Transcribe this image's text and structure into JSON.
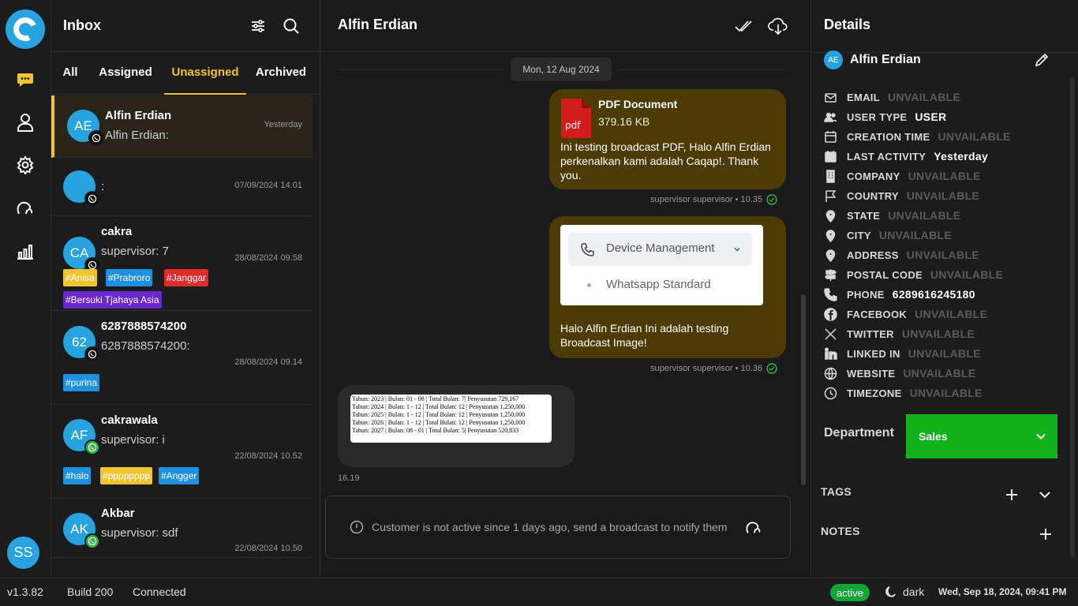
{
  "footer": {
    "version": "v1.3.82",
    "build": "Build 200",
    "connection": "Connected",
    "status": "active",
    "theme": "dark",
    "datetime": "Wed, Sep 18, 2024, 09:41 PM"
  },
  "rail": {
    "avatar": "SS",
    "icons": [
      "chat-icon",
      "contacts-icon",
      "settings-icon",
      "broadcast-icon",
      "analytics-icon"
    ]
  },
  "inbox": {
    "title": "Inbox",
    "tabs": [
      "All",
      "Assigned",
      "Unassigned",
      "Archived"
    ],
    "active_tab": "Unassigned",
    "conversations": [
      {
        "initials": "AE",
        "name": "Alfin Erdian",
        "preview": "Alfin Erdian:",
        "time": "Yesterday",
        "tags": []
      },
      {
        "initials": "",
        "name": "",
        "preview": ":",
        "time": "07/09/2024 14.01",
        "tags": []
      },
      {
        "initials": "CA",
        "name": "cakra",
        "preview": "supervisor:  7",
        "time": "28/08/2024 09.58",
        "tags": [
          {
            "label": "#Anisa",
            "color": "#f0c330"
          },
          {
            "label": "#Prabroro",
            "color": "#1e90e0"
          },
          {
            "label": "#Janggar",
            "color": "#e02b2b"
          },
          {
            "label": "#Bersuki Tjahaya Asia",
            "color": "#6a27c9"
          }
        ]
      },
      {
        "initials": "62",
        "name": "6287888574200",
        "preview": "6287888574200:",
        "time": "28/08/2024 09.14",
        "tags": [
          {
            "label": "#purina",
            "color": "#1e90e0"
          }
        ]
      },
      {
        "initials": "AF",
        "name": "cakrawala",
        "preview": "supervisor:  i",
        "time": "22/08/2024 10.52",
        "tags": [
          {
            "label": "#halo",
            "color": "#1e90e0"
          },
          {
            "label": "#pppppppp",
            "color": "#f0c330"
          },
          {
            "label": "#Angger",
            "color": "#1e90e0"
          }
        ]
      },
      {
        "initials": "AK",
        "name": "Akbar",
        "preview": "supervisor:  sdf",
        "time": "22/08/2024 10.50",
        "tags": []
      }
    ]
  },
  "chat": {
    "title": "Alfin Erdian",
    "date": "Mon, 12 Aug 2024",
    "messages": [
      {
        "doc_title": "PDF Document",
        "doc_size": "379.16 KB",
        "doc_icon": "pdf",
        "text": "Ini testing broadcast PDF, Halo Alfin Erdian perkenalkan kami adalah Caqap!. Thank you.",
        "meta": "supervisor supervisor • 10.35"
      },
      {
        "image_items": [
          "Device Management",
          "Whatsapp Standard"
        ],
        "text": "Halo Alfin Erdian Ini adalah testing Broadcast Image!",
        "meta": "supervisor supervisor • 10.36"
      },
      {
        "table_lines": [
          "Tahun: 2023 | Bulan: 01 - 08 | Total Bulan: 7| Penyusutan 729,167",
          "Tahun: 2024 | Bulan: 1 - 12 | Total Bulan: 12 | Penyusutan 1,250,000",
          "Tahun: 2025 | Bulan: 1 - 12 | Total Bulan: 12 | Penyusutan 1,250,000",
          "Tahun: 2026 | Bulan: 1 - 12 | Total Bulan: 12 | Penyusutan 1,250,000",
          "Tahun: 2027 | Bulan: 08 - 01 | Total Bulan: 5| Penyusutan 520,833"
        ],
        "meta": "16.19"
      }
    ],
    "notice": "Customer is not active since 1 days ago, send a broadcast to notify them"
  },
  "details": {
    "title": "Details",
    "contact_initials": "AE",
    "contact_name": "Alfin Erdian",
    "fields": [
      {
        "label": "EMAIL",
        "value": "UNVAILABLE",
        "on": false,
        "icon": "mail-icon"
      },
      {
        "label": "USER TYPE",
        "value": "USER",
        "on": true,
        "icon": "users-icon"
      },
      {
        "label": "CREATION TIME",
        "value": "UNVAILABLE",
        "on": false,
        "icon": "calendar-icon"
      },
      {
        "label": "LAST ACTIVITY",
        "value": "Yesterday",
        "on": true,
        "icon": "calendar-filled-icon"
      },
      {
        "label": "COMPANY",
        "value": "UNVAILABLE",
        "on": false,
        "icon": "building-icon"
      },
      {
        "label": "COUNTRY",
        "value": "UNVAILABLE",
        "on": false,
        "icon": "flag-icon"
      },
      {
        "label": "STATE",
        "value": "UNVAILABLE",
        "on": false,
        "icon": "pin-icon"
      },
      {
        "label": "CITY",
        "value": "UNVAILABLE",
        "on": false,
        "icon": "pin-icon"
      },
      {
        "label": "ADDRESS",
        "value": "UNVAILABLE",
        "on": false,
        "icon": "pin-icon"
      },
      {
        "label": "POSTAL CODE",
        "value": "UNVAILABLE",
        "on": false,
        "icon": "signpost-icon"
      },
      {
        "label": "PHONE",
        "value": "6289616245180",
        "on": true,
        "icon": "phone-icon"
      },
      {
        "label": "FACEBOOK",
        "value": "UNVAILABLE",
        "on": false,
        "icon": "facebook-icon"
      },
      {
        "label": "TWITTER",
        "value": "UNVAILABLE",
        "on": false,
        "icon": "x-icon"
      },
      {
        "label": "LINKED IN",
        "value": "UNVAILABLE",
        "on": false,
        "icon": "linkedin-icon"
      },
      {
        "label": "WEBSITE",
        "value": "UNVAILABLE",
        "on": false,
        "icon": "globe-icon"
      },
      {
        "label": "TIMEZONE",
        "value": "UNVAILABLE",
        "on": false,
        "icon": "clock-icon"
      }
    ],
    "department_label": "Department",
    "department_value": "Sales",
    "tags_label": "TAGS",
    "notes_label": "NOTES"
  },
  "colors": {
    "accent": "#f0c330",
    "brand": "#27a3e0",
    "bubble": "#4d3b05",
    "success": "#13b21c"
  }
}
